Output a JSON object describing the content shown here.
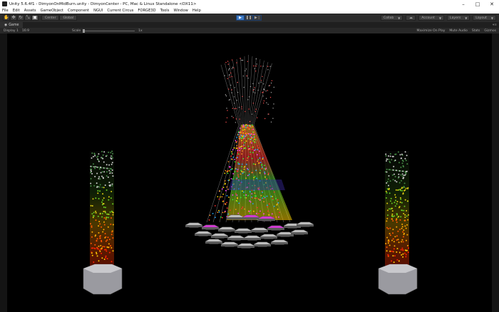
{
  "window": {
    "title": "Unity 5.6.4f1 - DimyonOnMidBurn.unity - DimyonCenter - PC, Mac & Linux Standalone <DX11>",
    "minimize": "–",
    "maximize": "□",
    "close": "✕"
  },
  "menu": [
    "File",
    "Edit",
    "Assets",
    "GameObject",
    "Component",
    "NGUI",
    "Current Circus",
    "FORGE3D",
    "Tools",
    "Window",
    "Help"
  ],
  "toolbar": {
    "pivot": "Center",
    "space": "Global",
    "collab": "Collab",
    "account": "Account",
    "layers": "Layers",
    "layout": "Layout"
  },
  "tab": {
    "label": "Game"
  },
  "game_controls": {
    "display": "Display 1",
    "aspect": "16:9",
    "scale_label": "Scale",
    "scale_value": "1x",
    "maximize_on_play": "Maximize On Play",
    "mute_audio": "Mute Audio",
    "stats": "Stats",
    "gizmos": "Gizmos"
  },
  "icons": {
    "hand": "hand-icon",
    "move": "move-icon",
    "rotate": "rotate-icon",
    "scale": "scale-icon",
    "rect": "rect-tool-icon",
    "play": "play-icon",
    "pause": "pause-icon",
    "step": "step-icon",
    "cloud": "cloud-icon"
  },
  "colors": {
    "editor_dark": "#2c2c2c",
    "play_active": "#3b78c4",
    "viewport": "#000000"
  }
}
